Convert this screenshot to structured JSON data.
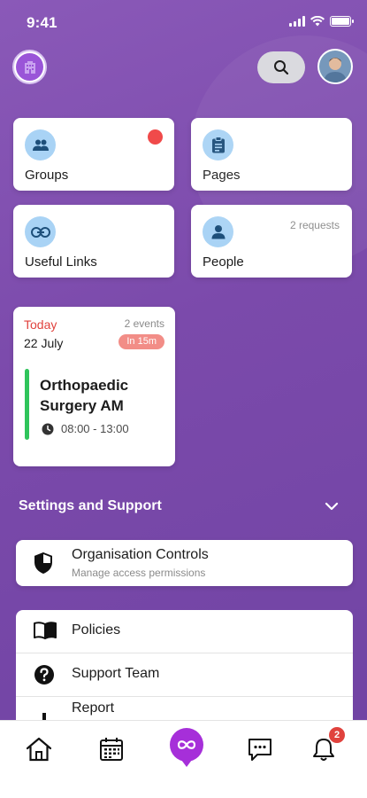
{
  "status_bar": {
    "time": "9:41"
  },
  "header": {
    "org_logo_icon": "building-icon",
    "search_icon": "search-icon",
    "avatar_icon": "user-photo"
  },
  "tiles": [
    {
      "label": "Groups",
      "icon": "groups-icon",
      "badge": "red-dot"
    },
    {
      "label": "Pages",
      "icon": "clipboard-icon"
    },
    {
      "label": "Useful Links",
      "icon": "link-icon"
    },
    {
      "label": "People",
      "icon": "person-icon",
      "meta": "2 requests"
    }
  ],
  "event": {
    "day_label": "Today",
    "date": "22 July",
    "count": "2 events",
    "badge": "In 15m",
    "title": "Orthopaedic Surgery AM",
    "time": "08:00 - 13:00"
  },
  "settings": {
    "section_title": "Settings and Support",
    "org_controls": {
      "title": "Organisation Controls",
      "subtitle": "Manage access permissions"
    },
    "items": [
      {
        "label": "Policies",
        "icon": "book-icon"
      },
      {
        "label": "Support Team",
        "icon": "help-icon"
      },
      {
        "label": "Report",
        "icon": "report-icon"
      }
    ]
  },
  "tabbar": {
    "notifications_count": "2",
    "items": [
      "home-icon",
      "calendar-icon",
      "app-logo-icon",
      "chat-icon",
      "bell-icon"
    ]
  },
  "colors": {
    "background": "#7b4aab",
    "accent": "#a62fd9",
    "icon_circle": "#a9d3f5",
    "event_today": "#e0423d",
    "event_bar": "#2fc45b",
    "badge": "#f28d87"
  }
}
